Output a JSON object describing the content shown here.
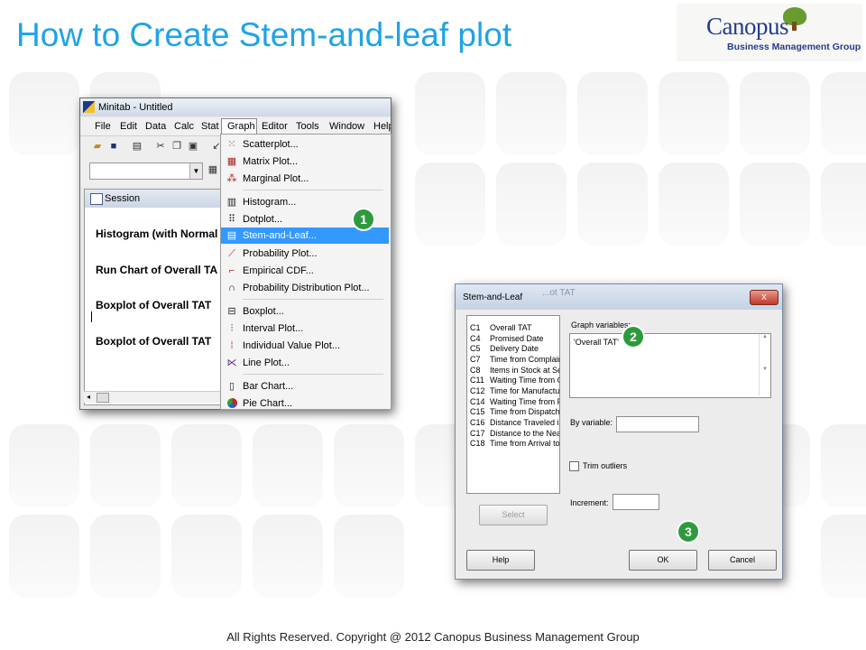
{
  "slide": {
    "title": "How to Create Stem-and-leaf plot",
    "footer": "All Rights Reserved. Copyright @ 2012 Canopus Business Management Group"
  },
  "logo": {
    "name": "Canopus",
    "subtitle": "Business Management Group"
  },
  "minitab": {
    "window_title": "Minitab - Untitled",
    "menus": [
      "File",
      "Edit",
      "Data",
      "Calc",
      "Stat",
      "Graph",
      "Editor",
      "Tools",
      "Window",
      "Help"
    ],
    "open_menu": "Graph",
    "session": {
      "title": "Session",
      "lines": [
        "Histogram (with Normal",
        "Run Chart of Overall TA",
        "Boxplot of Overall TAT",
        "Boxplot of Overall TAT"
      ]
    },
    "graph_menu": [
      {
        "label": "Scatterplot...",
        "icon": "scatterplot-icon"
      },
      {
        "label": "Matrix Plot...",
        "icon": "matrix-plot-icon"
      },
      {
        "label": "Marginal Plot...",
        "icon": "marginal-plot-icon"
      },
      {
        "label": "Histogram...",
        "icon": "histogram-icon"
      },
      {
        "label": "Dotplot...",
        "icon": "dotplot-icon"
      },
      {
        "label": "Stem-and-Leaf...",
        "icon": "stem-and-leaf-icon",
        "highlighted": true
      },
      {
        "label": "Probability Plot...",
        "icon": "probability-plot-icon"
      },
      {
        "label": "Empirical CDF...",
        "icon": "empirical-cdf-icon"
      },
      {
        "label": "Probability Distribution Plot...",
        "icon": "distribution-plot-icon"
      },
      {
        "label": "Boxplot...",
        "icon": "boxplot-icon"
      },
      {
        "label": "Interval Plot...",
        "icon": "interval-plot-icon"
      },
      {
        "label": "Individual Value Plot...",
        "icon": "individual-value-plot-icon"
      },
      {
        "label": "Line Plot...",
        "icon": "line-plot-icon"
      },
      {
        "label": "Bar Chart...",
        "icon": "bar-chart-icon"
      },
      {
        "label": "Pie Chart...",
        "icon": "pie-chart-icon"
      }
    ]
  },
  "steps": [
    "1",
    "2",
    "3"
  ],
  "dialog": {
    "title": "Stem-and-Leaf",
    "ghost_title": "...ot TAT",
    "variables": [
      {
        "col": "C1",
        "name": "Overall TAT"
      },
      {
        "col": "C4",
        "name": "Promised Date"
      },
      {
        "col": "C5",
        "name": "Delivery Date"
      },
      {
        "col": "C7",
        "name": "Time from Complaint"
      },
      {
        "col": "C8",
        "name": "Items in Stock at Ser"
      },
      {
        "col": "C11",
        "name": "Waiting Time from O"
      },
      {
        "col": "C12",
        "name": "Time for Manufactur"
      },
      {
        "col": "C14",
        "name": "Waiting Time from Pa"
      },
      {
        "col": "C15",
        "name": "Time from Dispatch t"
      },
      {
        "col": "C16",
        "name": "Distance Traveled in"
      },
      {
        "col": "C17",
        "name": "Distance to the Near"
      },
      {
        "col": "C18",
        "name": "Time from Arrival to"
      }
    ],
    "graph_variables_label": "Graph variables:",
    "graph_variables_value": "'Overall TAT'",
    "by_variable_label": "By variable:",
    "by_variable_value": "",
    "trim_outliers_label": "Trim outliers",
    "trim_outliers_checked": false,
    "increment_label": "Increment:",
    "increment_value": "",
    "select_button": "Select",
    "help_button": "Help",
    "ok_button": "OK",
    "cancel_button": "Cancel",
    "close_glyph": "x"
  },
  "colors": {
    "title": "#1fa3e6",
    "badge": "#2e9a3e",
    "menu_highlight": "#3399ff",
    "logo": "#253c8c"
  }
}
